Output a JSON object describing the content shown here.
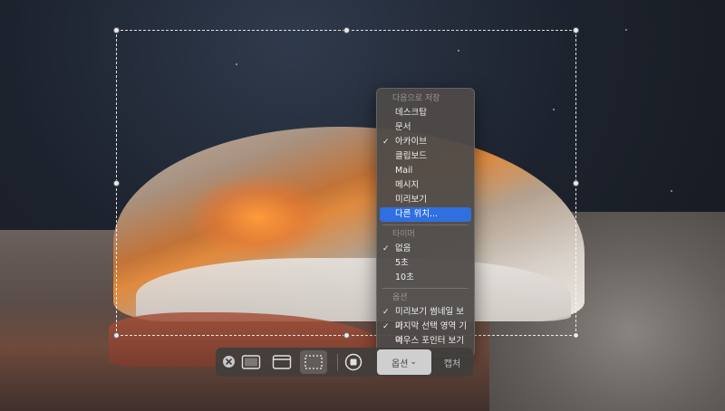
{
  "menu": {
    "save_to_header": "다음으로 저장",
    "save_items": [
      {
        "label": "데스크탑",
        "checked": false,
        "highlighted": false
      },
      {
        "label": "문서",
        "checked": false,
        "highlighted": false
      },
      {
        "label": "아카이브",
        "checked": true,
        "highlighted": false
      },
      {
        "label": "클립보드",
        "checked": false,
        "highlighted": false
      },
      {
        "label": "Mail",
        "checked": false,
        "highlighted": false
      },
      {
        "label": "메시지",
        "checked": false,
        "highlighted": false
      },
      {
        "label": "미리보기",
        "checked": false,
        "highlighted": false
      },
      {
        "label": "다른 위치...",
        "checked": false,
        "highlighted": true
      }
    ],
    "timer_header": "타이머",
    "timer_items": [
      {
        "label": "없음",
        "checked": true
      },
      {
        "label": "5초",
        "checked": false
      },
      {
        "label": "10초",
        "checked": false
      }
    ],
    "options_header": "옵션",
    "option_items": [
      {
        "label": "미리보기 썸네일 보기",
        "checked": true
      },
      {
        "label": "마지막 선택 영역 기억",
        "checked": true
      },
      {
        "label": "마우스 포인터 보기",
        "checked": false
      }
    ]
  },
  "toolbar": {
    "options_label": "옵션",
    "options_chevron": "⌄",
    "capture_label": "캡처"
  },
  "check_glyph": "✓",
  "colors": {
    "highlight": "#2f6fe0",
    "menu_bg": "#4e4a48"
  }
}
